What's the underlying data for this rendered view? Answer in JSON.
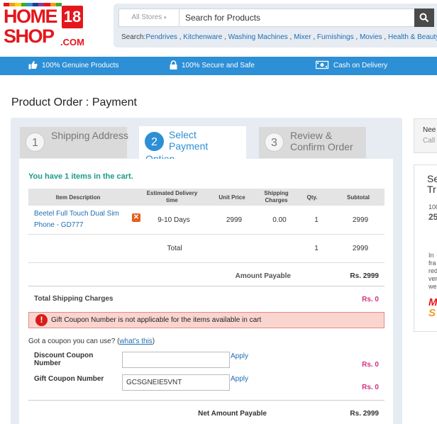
{
  "logo": {
    "line1": "HOME",
    "line2": "SHOP",
    "num": "18",
    "com": ".COM",
    "bar_colors": [
      "#e4161c",
      "#f39a1e",
      "#fcd116",
      "#3aaa35",
      "#2d8fd5",
      "#1d3f8f",
      "#8e3b96",
      "#e4161c",
      "#f39a1e",
      "#3aaa35"
    ]
  },
  "search": {
    "stores_label": "All Stores",
    "placeholder": "Search for Products",
    "quick_label": "Search:",
    "quick_links": [
      "Pendrives",
      "Kitchenware",
      "Washing Machines",
      "Mixer",
      "Furnishings",
      "Movies",
      "Health & Beauty"
    ]
  },
  "trust_bar": {
    "genuine": "100% Genuine Products",
    "secure": "100% Secure and Safe",
    "cod": "Cash on Delivery"
  },
  "page_title": "Product Order : Payment",
  "steps": [
    {
      "num": "1",
      "label": "Shipping Address"
    },
    {
      "num": "2",
      "label": "Select Payment",
      "label_cont": "Option"
    },
    {
      "num": "3",
      "label": "Review & Confirm Order"
    }
  ],
  "cart": {
    "msg_prefix": "You have ",
    "count": "1",
    "msg_suffix": " items in the cart."
  },
  "table": {
    "headers": {
      "desc": "Item Description",
      "delivery": "Estimated Delivery time",
      "price": "Unit Price",
      "shipping": "Shipping Charges",
      "qty": "Qty.",
      "subtotal": "Subtotal"
    },
    "row": {
      "name": "Beetel Full Touch Dual Sim Phone - GD777",
      "remove_glyph": "✕",
      "delivery": "9-10 Days",
      "price": "2999",
      "shipping": "0.00",
      "qty": "1",
      "subtotal": "2999"
    },
    "total": {
      "label": "Total",
      "qty": "1",
      "subtotal": "2999"
    }
  },
  "amount_payable": {
    "label": "Amount Payable",
    "value": "Rs. 2999"
  },
  "shipping_charges": {
    "label": "Total Shipping Charges",
    "value": "Rs. 0"
  },
  "error": {
    "icon": "!",
    "message": "Gift Coupon Number is not applicable for the items available in cart"
  },
  "coupon": {
    "question": "Got a coupon you can use? (",
    "whats_this": "what's this",
    "close_paren": ")",
    "discount_label": "Discount Coupon Number",
    "discount_value": "",
    "discount_apply": "Apply",
    "discount_amount": "Rs. 0",
    "gift_label": "Gift Coupon Number",
    "gift_value": "GCSGNEIE5VNT",
    "gift_apply": "Apply",
    "gift_amount": "Rs. 0"
  },
  "net_amount": {
    "label": "Net Amount Payable",
    "value": "Rs. 2999"
  },
  "sidebar": {
    "need": "Nee",
    "call": "Call",
    "se": "Se",
    "tr": "Tr",
    "n100": "100",
    "n25": "25",
    "in_text": [
      "In",
      "fra",
      "red",
      "ver",
      "we"
    ]
  }
}
